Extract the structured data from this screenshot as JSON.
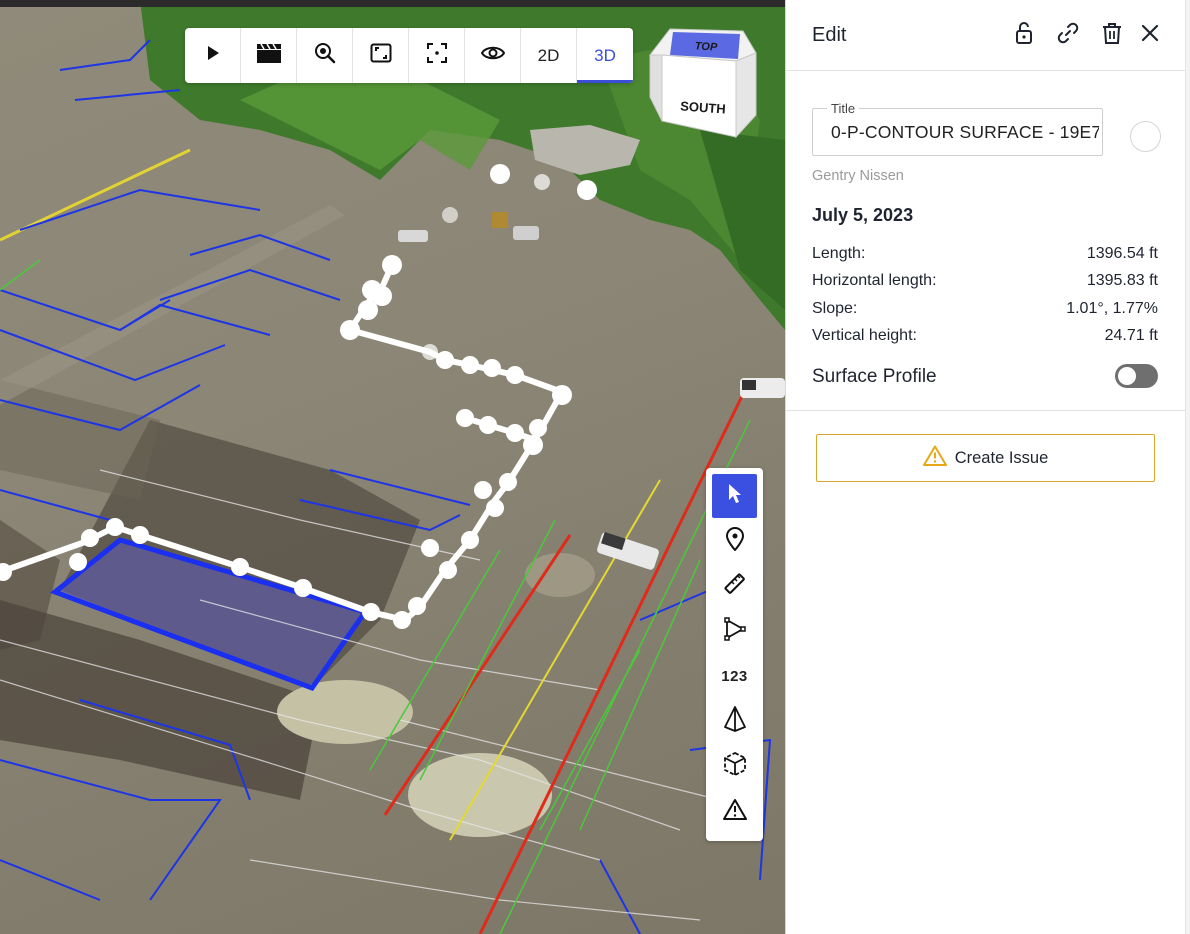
{
  "toolbar": {
    "items": [
      {
        "name": "play-icon"
      },
      {
        "name": "clapperboard-icon"
      },
      {
        "name": "zoom-search-icon"
      },
      {
        "name": "fit-frame-icon"
      },
      {
        "name": "focus-frame-icon"
      },
      {
        "name": "eye-icon"
      },
      {
        "label": "2D"
      },
      {
        "label": "3D",
        "active": true
      }
    ]
  },
  "viewcube": {
    "top_label": "TOP",
    "side_label": "SOUTH"
  },
  "palette": {
    "items": [
      {
        "name": "pointer-icon",
        "active": true
      },
      {
        "name": "location-pin-icon"
      },
      {
        "name": "ruler-icon"
      },
      {
        "name": "polyline-icon"
      },
      {
        "label": "123"
      },
      {
        "name": "volume-pyramid-icon"
      },
      {
        "name": "cube-icon"
      },
      {
        "name": "warning-icon"
      }
    ]
  },
  "panel": {
    "header_title": "Edit",
    "header_icons": [
      "lock-icon",
      "link-icon",
      "trash-icon",
      "close-icon"
    ],
    "title_legend": "Title",
    "title_value": "0-P-CONTOUR SURFACE - 19E7",
    "author": "Gentry Nissen",
    "date": "July 5, 2023",
    "stats": [
      {
        "label": "Length:",
        "value": "1396.54 ft"
      },
      {
        "label": "Horizontal length:",
        "value": "1395.83 ft"
      },
      {
        "label": "Slope:",
        "value": "1.01°, 1.77%"
      },
      {
        "label": "Vertical height:",
        "value": "24.71 ft"
      }
    ],
    "surface_profile_label": "Surface Profile",
    "surface_profile_on": false,
    "create_issue_label": "Create Issue"
  },
  "colors": {
    "accent": "#3b4fe0",
    "issue_border": "#d9a62b",
    "warning": "#e6a817"
  }
}
